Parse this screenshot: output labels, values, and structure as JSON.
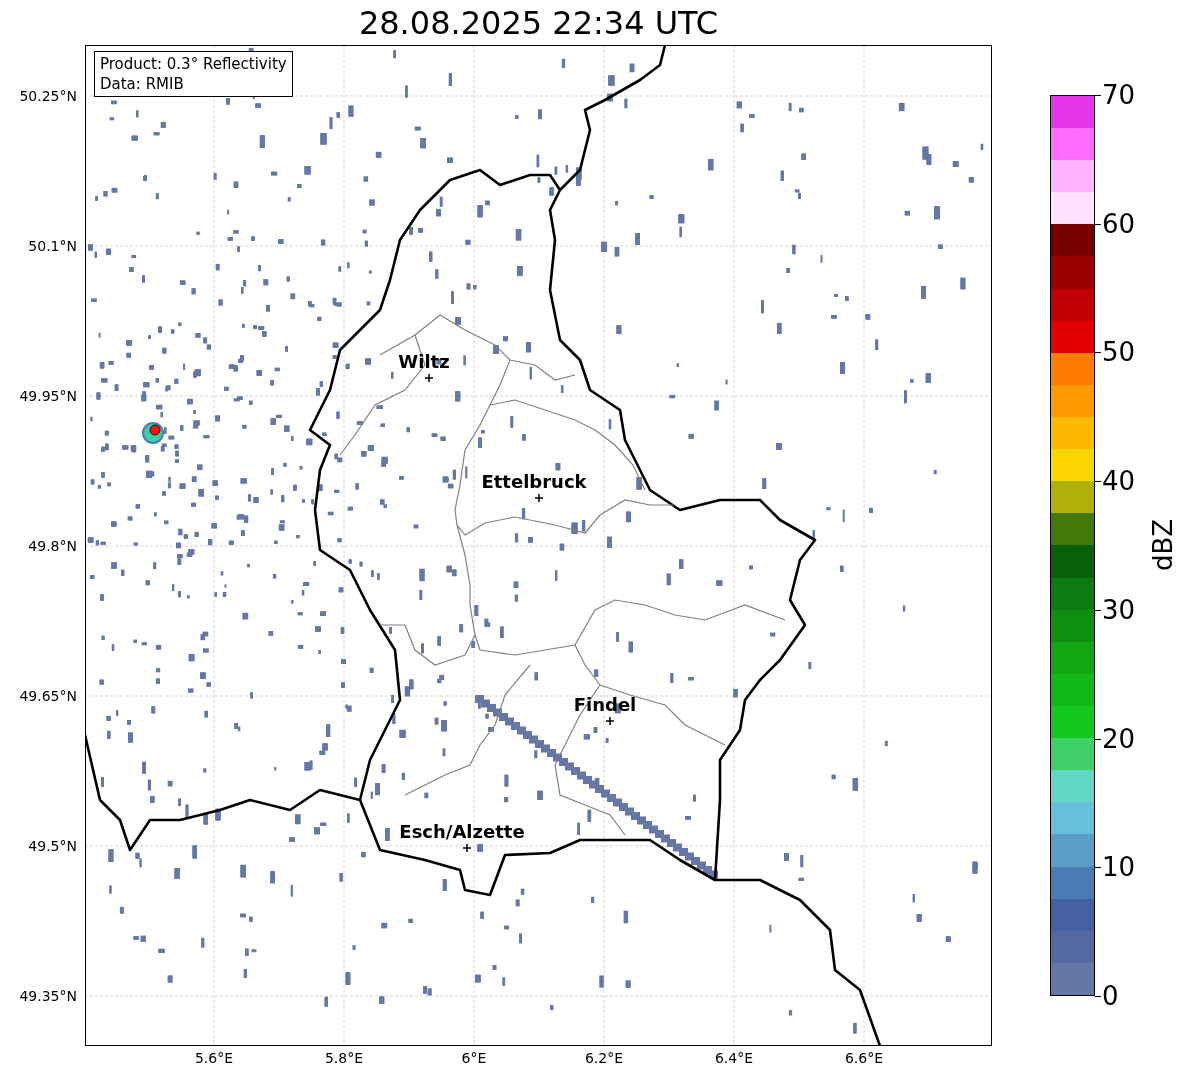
{
  "title": "28.08.2025 22:34 UTC",
  "map": {
    "info": [
      "Product: 0.3° Reflectivity",
      "Data: RMIB"
    ],
    "latitude_labels": [
      "50.25°N",
      "50.1°N",
      "49.95°N",
      "49.8°N",
      "49.65°N",
      "49.5°N",
      "49.35°N"
    ],
    "longitude_labels": [
      "5.6°E",
      "5.8°E",
      "6°E",
      "6.2°E",
      "6.4°E",
      "6.6°E"
    ],
    "cities": [
      {
        "label": "Wiltz"
      },
      {
        "label": "Ettelbruck"
      },
      {
        "label": "Findel"
      },
      {
        "label": "Esch/Alzette"
      }
    ]
  },
  "colorbar": {
    "label": "dBZ",
    "ticks": [
      "70",
      "60",
      "50",
      "40",
      "30",
      "20",
      "10",
      "0"
    ],
    "bins": [
      {
        "color": "#6577a6"
      },
      {
        "color": "#5469a0"
      },
      {
        "color": "#4560a0"
      },
      {
        "color": "#4a7bb5"
      },
      {
        "color": "#5a9ec8"
      },
      {
        "color": "#65c0dc"
      },
      {
        "color": "#62d6c4"
      },
      {
        "color": "#3ecf6a"
      },
      {
        "color": "#12c81e"
      },
      {
        "color": "#12b818"
      },
      {
        "color": "#11a713"
      },
      {
        "color": "#0f8f12"
      },
      {
        "color": "#0d7a10"
      },
      {
        "color": "#095f0a"
      },
      {
        "color": "#43780a"
      },
      {
        "color": "#b0b008"
      },
      {
        "color": "#fbd600"
      },
      {
        "color": "#fdb800"
      },
      {
        "color": "#fe9a00"
      },
      {
        "color": "#fe7d00"
      },
      {
        "color": "#e30000"
      },
      {
        "color": "#c00000"
      },
      {
        "color": "#9a0000"
      },
      {
        "color": "#760000"
      },
      {
        "color": "#ffe0ff"
      },
      {
        "color": "#ffb4ff"
      },
      {
        "color": "#ff6cff"
      },
      {
        "color": "#e535e8"
      }
    ]
  }
}
